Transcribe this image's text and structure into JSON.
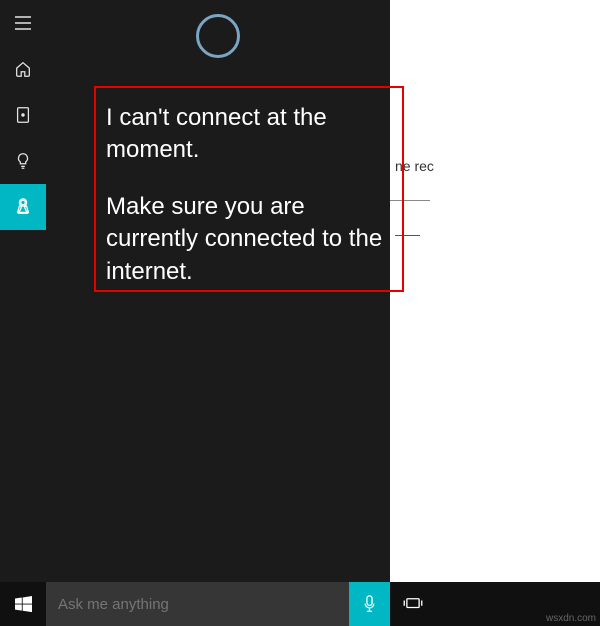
{
  "cortana": {
    "message_line1": "I can't connect at the moment.",
    "message_line2": "Make sure you are currently connected to the internet."
  },
  "taskbar": {
    "search_placeholder": "Ask me anything"
  },
  "background": {
    "partial_text": "ne rec"
  },
  "watermark": "wsxdn.com",
  "colors": {
    "accent": "#00b7c3",
    "panel_bg": "#1b1b1b",
    "searchbox_bg": "#363636",
    "highlight_border": "#e60000"
  }
}
